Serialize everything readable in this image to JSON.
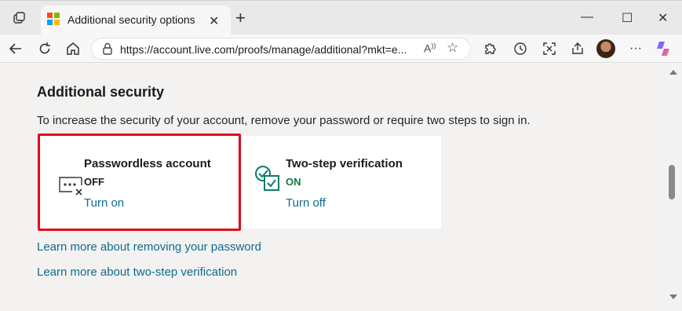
{
  "browser": {
    "tab_title": "Additional security options",
    "tab_close_glyph": "✕",
    "new_tab_glyph": "+",
    "url_prefix": "https://",
    "url_host": "account.live.com",
    "url_path": "/proofs/manage/additional?mkt=e...",
    "window_controls": {
      "minimize": "—",
      "maximize": "☐",
      "close": "✕"
    }
  },
  "page": {
    "heading": "Additional security",
    "description": "To increase the security of your account, remove your password or require two steps to sign in.",
    "cards": [
      {
        "title": "Passwordless account",
        "status": "OFF",
        "action": "Turn on",
        "icon": "passwordless-icon",
        "status_color": "#1b1b1b"
      },
      {
        "title": "Two-step verification",
        "status": "ON",
        "action": "Turn off",
        "icon": "two-step-check-icon",
        "status_color": "#107c41"
      }
    ],
    "links": [
      "Learn more about removing your password",
      "Learn more about two-step verification"
    ]
  },
  "colors": {
    "accent_link": "#0e6b8f",
    "highlight_border": "#e00b1c",
    "on_status": "#107c41"
  }
}
